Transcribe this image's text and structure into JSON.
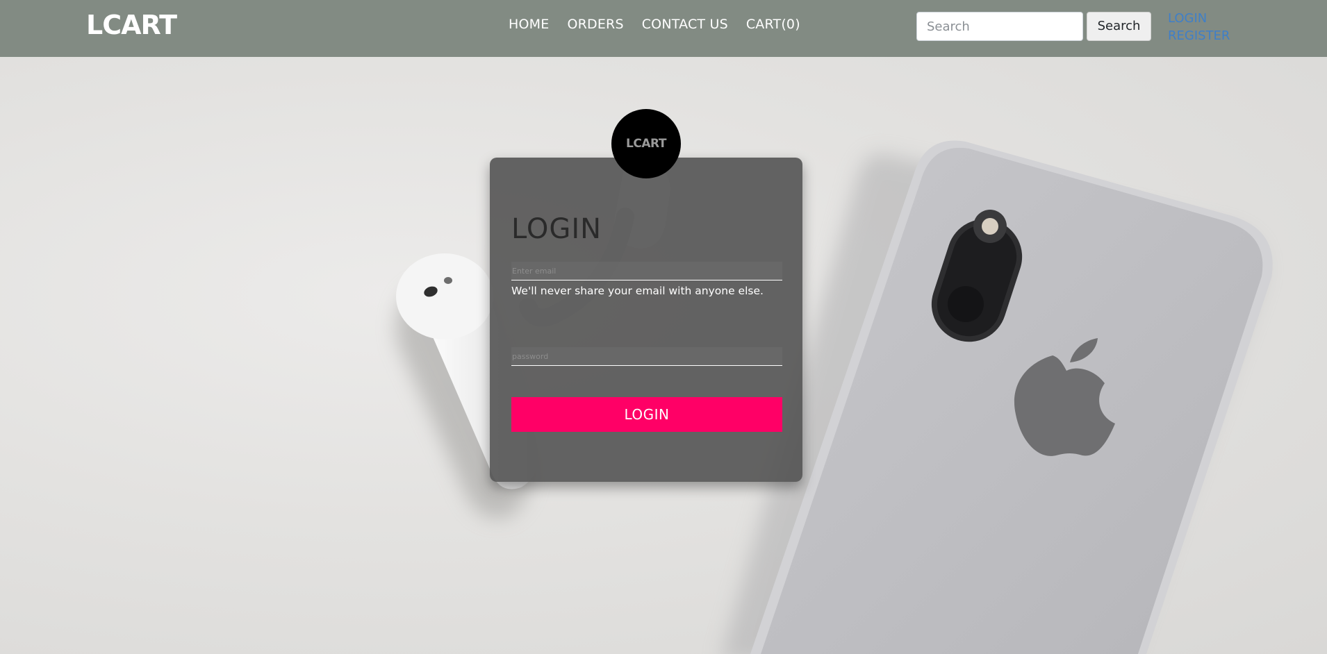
{
  "navbar": {
    "brand": "LCART",
    "links": [
      {
        "label": "HOME"
      },
      {
        "label": "ORDERS"
      },
      {
        "label": "CONTACT US"
      },
      {
        "label": "CART(0)"
      }
    ],
    "search": {
      "placeholder": "Search",
      "value": "",
      "button_label": "Search"
    },
    "auth": {
      "login_label": "LOGIN",
      "register_label": "REGISTER"
    }
  },
  "login_form": {
    "logo_text": "LCART",
    "title": "LOGIN",
    "email": {
      "placeholder": "Enter email",
      "value": ""
    },
    "email_help": "We'll never share your email with anyone else.",
    "password": {
      "placeholder": "password",
      "value": ""
    },
    "submit_label": "LOGIN"
  },
  "colors": {
    "navbar_bg": "#828b83",
    "accent": "#ff0066",
    "link": "#3f7fc8"
  },
  "background": {
    "icons": [
      "earbud-image",
      "smartphone-image",
      "apple-logo-icon"
    ]
  }
}
